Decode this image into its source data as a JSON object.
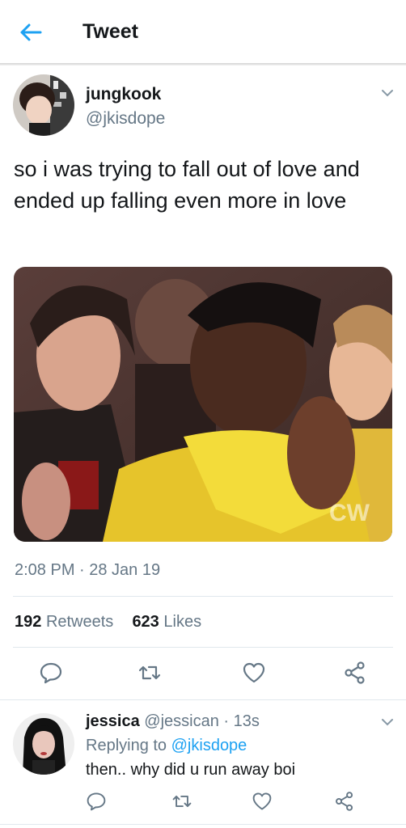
{
  "header": {
    "title": "Tweet",
    "back_icon": "arrow-left-icon",
    "accent": "#1da1f2"
  },
  "tweet": {
    "author_name": "jungkook",
    "author_handle": "@jkisdope",
    "text": "so i was trying to fall out of love and ended up falling even more in love",
    "media_watermark": "CW",
    "timestamp": "2:08 PM · 28 Jan 19",
    "retweet_count": "192",
    "retweet_label": "Retweets",
    "like_count": "623",
    "like_label": "Likes",
    "actions": [
      "reply-icon",
      "retweet-icon",
      "heart-icon",
      "share-icon"
    ]
  },
  "reply": {
    "author_name": "jessica",
    "author_handle": "@jessican",
    "time": "13s",
    "replying_prefix": "Replying to",
    "replying_handle": "@jkisdope",
    "text": "then.. why did u run away boi",
    "actions": [
      "reply-icon",
      "retweet-icon",
      "heart-icon",
      "share-icon"
    ]
  },
  "colors": {
    "text": "#14171a",
    "secondary": "#657786",
    "divider": "#e1e8ed",
    "link": "#1da1f2",
    "icon": "#657786"
  }
}
